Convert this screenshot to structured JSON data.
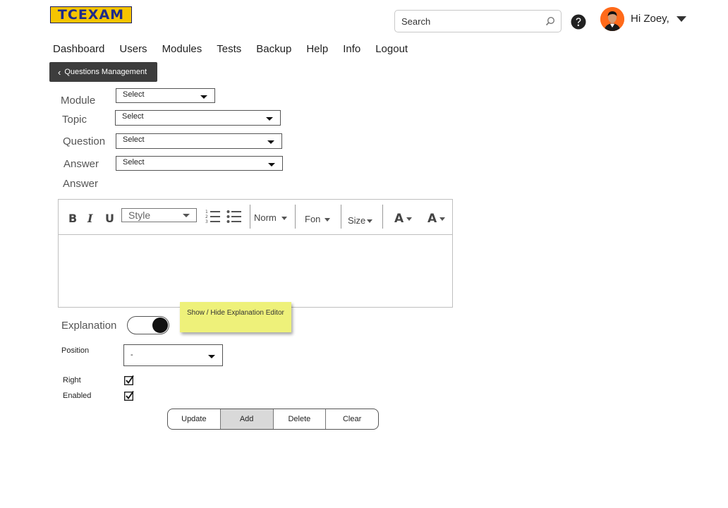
{
  "header": {
    "logo_text": "TCEXAM",
    "search_placeholder": "Search",
    "greeting": "Hi Zoey,"
  },
  "nav": [
    "Dashboard",
    "Users",
    "Modules",
    "Tests",
    "Backup",
    "Help",
    "Info",
    "Logout"
  ],
  "back_button": "Questions Management",
  "form": {
    "module_label": "Module",
    "module_value": "Select",
    "topic_label": "Topic",
    "topic_value": "Select",
    "question_label": "Question",
    "question_value": "Select",
    "answer_label": "Answer",
    "answer_value": "Select",
    "answer_editor_label": "Answer"
  },
  "editor": {
    "bold": "B",
    "italic": "I",
    "underline": "U",
    "style": "Style",
    "format": "Norm",
    "font": "Fon",
    "size": "Size",
    "text_color": "A",
    "bg_color": "A"
  },
  "explanation": {
    "label": "Explanation",
    "enabled": true,
    "tooltip": "Show / Hide Explanation Editor"
  },
  "position": {
    "label": "Position",
    "value": "-"
  },
  "right": {
    "label": "Right",
    "checked": true
  },
  "enabled": {
    "label": "Enabled",
    "checked": true
  },
  "buttons": {
    "update": "Update",
    "add": "Add",
    "delete": "Delete",
    "clear": "Clear"
  },
  "colors": {
    "logo_bg": "#f5c400",
    "back_button_bg": "#3d3d3d",
    "tooltip_bg": "#eef17a"
  }
}
